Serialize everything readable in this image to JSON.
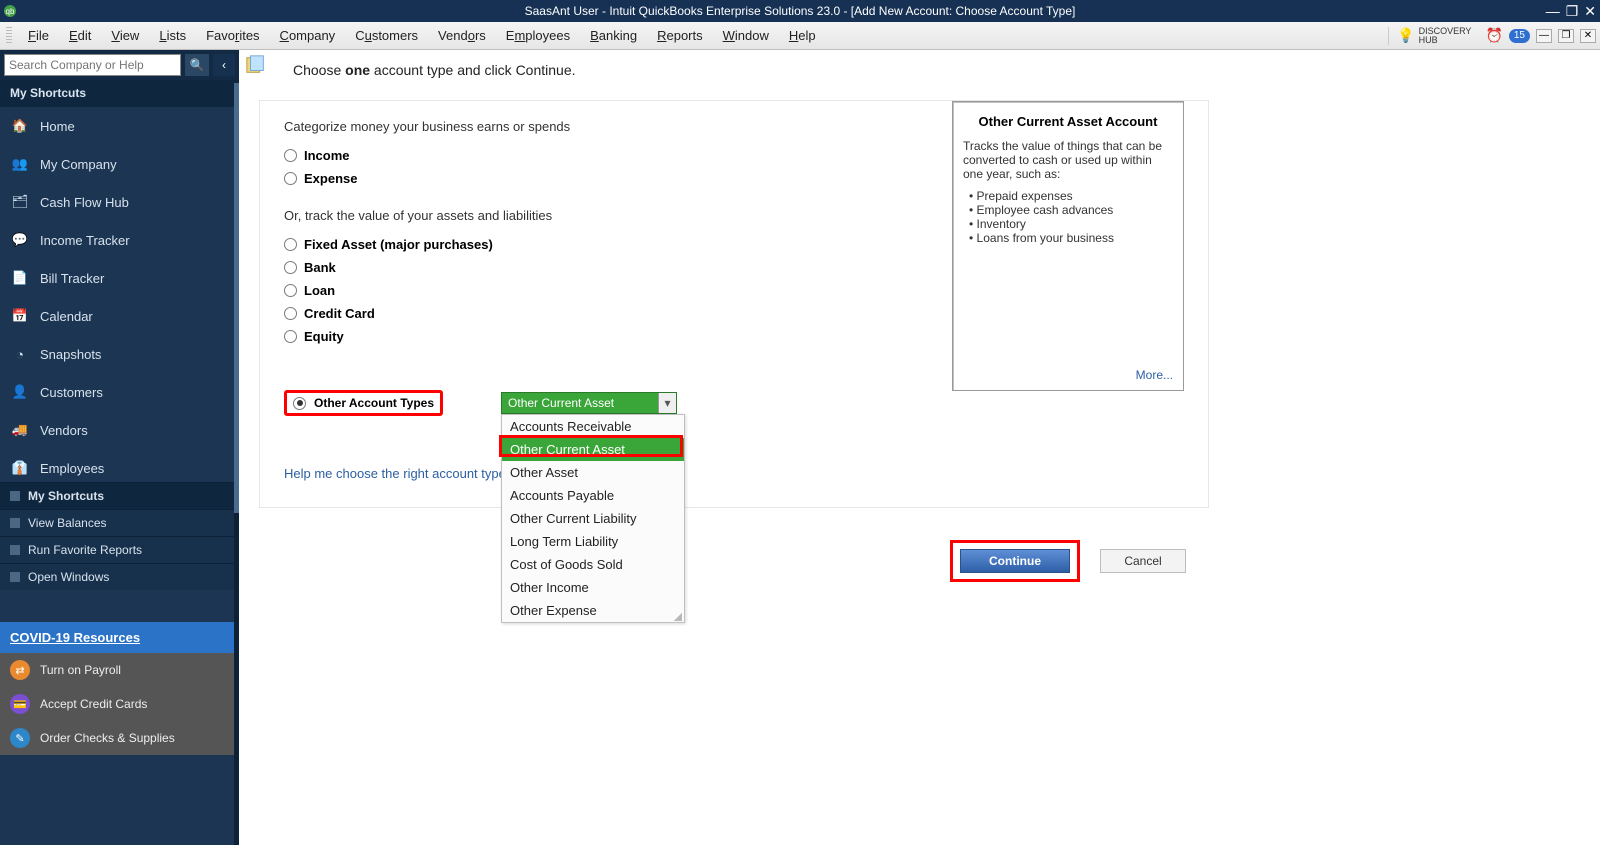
{
  "titlebar": {
    "title": "SaasAnt User  -  Intuit QuickBooks Enterprise Solutions 23.0 - [Add New Account: Choose Account Type]"
  },
  "menubar": {
    "items": [
      "File",
      "Edit",
      "View",
      "Lists",
      "Favorites",
      "Company",
      "Customers",
      "Vendors",
      "Employees",
      "Banking",
      "Reports",
      "Window",
      "Help"
    ],
    "discovery_upper": "DISCOVERY",
    "discovery_lower": "HUB",
    "badge": "15"
  },
  "sidebar": {
    "search_placeholder": "Search Company or Help",
    "my_shortcuts": "My Shortcuts",
    "items": [
      {
        "icon": "home",
        "label": "Home"
      },
      {
        "icon": "company",
        "label": "My Company"
      },
      {
        "icon": "cash",
        "label": "Cash Flow Hub"
      },
      {
        "icon": "income",
        "label": "Income Tracker"
      },
      {
        "icon": "bill",
        "label": "Bill Tracker"
      },
      {
        "icon": "calendar",
        "label": "Calendar"
      },
      {
        "icon": "pie",
        "label": "Snapshots"
      },
      {
        "icon": "person",
        "label": "Customers"
      },
      {
        "icon": "truck",
        "label": "Vendors"
      },
      {
        "icon": "people",
        "label": "Employees"
      }
    ],
    "subs": [
      "My Shortcuts",
      "View Balances",
      "Run Favorite Reports",
      "Open Windows"
    ],
    "covid": "COVID-19 Resources",
    "resources": [
      {
        "label": "Turn on Payroll",
        "color": "#e98a2e"
      },
      {
        "label": "Accept Credit Cards",
        "color": "#7a4fd1"
      },
      {
        "label": "Order Checks & Supplies",
        "color": "#2e87c8"
      }
    ]
  },
  "main": {
    "choose_pre": "Choose ",
    "choose_one": "one",
    "choose_post": " account type and click Continue.",
    "prompt1": "Categorize money your business earns or spends",
    "prompt2": "Or, track the value of your assets and liabilities",
    "radios1": [
      "Income",
      "Expense"
    ],
    "radios2": [
      "Fixed Asset (major purchases)",
      "Bank",
      "Loan",
      "Credit Card",
      "Equity"
    ],
    "other_label": "Other Account Types",
    "dropdown_selected": "Other Current Asset",
    "dropdown_options": [
      "Accounts Receivable",
      "Other Current Asset",
      "Other Asset",
      "Accounts Payable",
      "Other Current Liability",
      "Long Term Liability",
      "Cost of Goods Sold",
      "Other Income",
      "Other Expense"
    ],
    "help_link": "Help me choose the right account type.",
    "helpbox": {
      "title": "Other Current Asset Account",
      "desc": "Tracks the value of things that can be converted to cash or used up within one year, such as:",
      "bullets": [
        "Prepaid expenses",
        "Employee cash advances",
        "Inventory",
        "Loans from your business"
      ],
      "more": "More..."
    },
    "continue": "Continue",
    "cancel": "Cancel"
  }
}
